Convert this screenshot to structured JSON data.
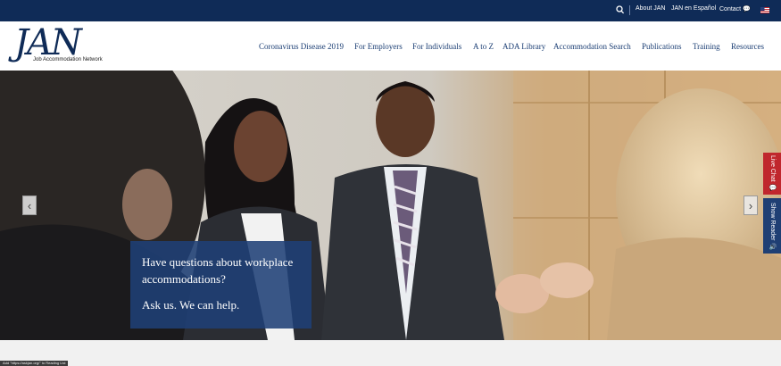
{
  "topbar": {
    "links": [
      {
        "label": "About JAN"
      },
      {
        "label": "JAN en Español"
      },
      {
        "label": "Contact 💬"
      }
    ]
  },
  "header": {
    "logo_text": "JAN",
    "logo_subtitle": "Job Accommodation Network",
    "nav": [
      {
        "label": "Coronavirus Disease 2019"
      },
      {
        "label": "For Employers"
      },
      {
        "label": "For Individuals"
      },
      {
        "label": "A to Z"
      },
      {
        "label": "ADA Library"
      },
      {
        "label": "Accommodation Search"
      },
      {
        "label": "Publications"
      },
      {
        "label": "Training"
      },
      {
        "label": "Resources"
      }
    ]
  },
  "hero": {
    "caption_question": "Have questions about workplace accommodations?",
    "caption_answer": "Ask us. We can help.",
    "prev_arrow": "‹",
    "next_arrow": "›"
  },
  "side_tabs": {
    "live_chat": "Live Chat 💬",
    "show_reader": "Show Reader 🔊"
  },
  "status_bar": {
    "text": "Add \"https://askjan.org/\" to Reading List"
  },
  "colors": {
    "navy": "#0f2b57",
    "link": "#1a3d73",
    "caption_bg": "#1f4076",
    "live_chat": "#c0272d",
    "show_reader": "#1f3f74"
  }
}
